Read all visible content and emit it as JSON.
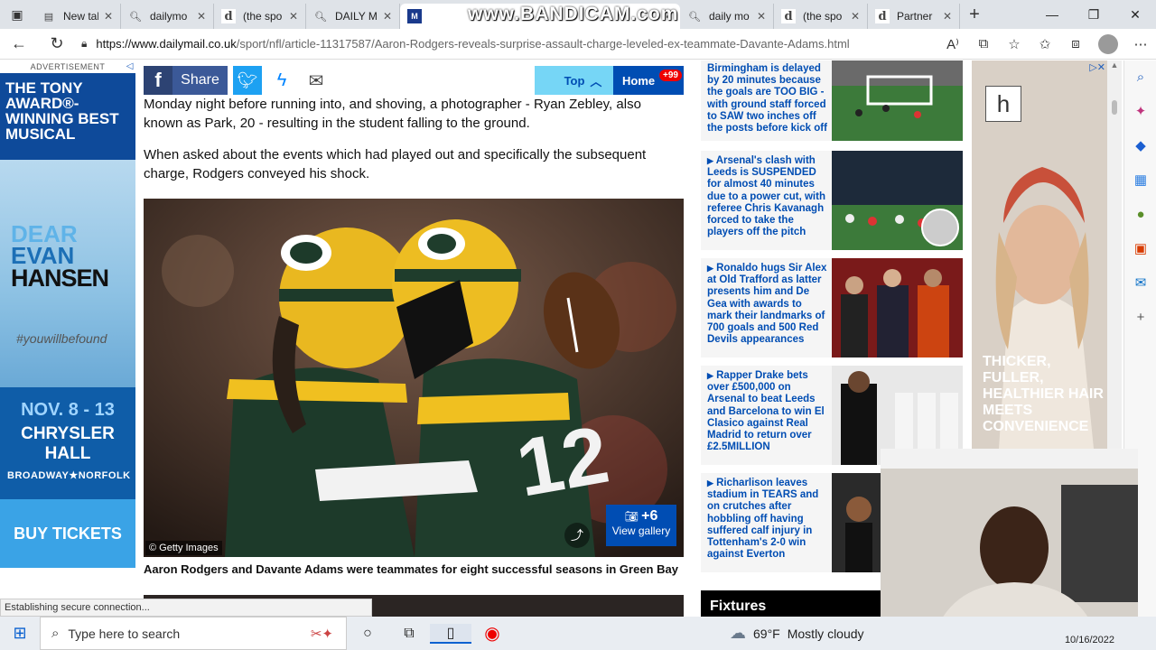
{
  "browser": {
    "tabs": [
      {
        "icon": "newtab",
        "title": "New tab"
      },
      {
        "icon": "search",
        "title": "dailymo"
      },
      {
        "icon": "doc",
        "title": "(the spo"
      },
      {
        "icon": "search",
        "title": "DAILY M"
      },
      {
        "icon": "dm",
        "title": "",
        "active": true
      },
      {
        "icon": "search",
        "title": "daily mo"
      },
      {
        "icon": "doc",
        "title": "(the spo"
      },
      {
        "icon": "doc",
        "title": "Partner"
      }
    ],
    "watermark": "www.BANDICAM.com",
    "url_host": "https://www.dailymail.co.uk",
    "url_path": "/sport/nfl/article-11317587/Aaron-Rodgers-reveals-surprise-assault-charge-leveled-ex-teammate-Davante-Adams.html",
    "status_text": "Establishing secure connection..."
  },
  "left_ad": {
    "label": "ADVERTISEMENT",
    "headline": "THE TONY AWARD®- WINNING BEST MUSICAL",
    "show_line1": "DEAR",
    "show_line2": "EVAN",
    "show_line3": "HANSEN",
    "hashtag": "#youwillbefound",
    "dates": "NOV. 8 - 13",
    "venue": "CHRYSLER HALL",
    "presenter": "BROADWAY★NORFOLK",
    "cta": "BUY TICKETS"
  },
  "article": {
    "share_label": "Share",
    "top_label": "Top",
    "home_label": "Home",
    "home_badge": "+99",
    "para1": "Monday night before running into, and shoving, a photographer - Ryan Zebley, also known as Park, 20 - resulting in the student falling to the ground.",
    "para2": "When asked about the events which had played out and specifically the subsequent charge, Rodgers conveyed his shock.",
    "photo_credit": "© Getty Images",
    "gallery_count": "+6",
    "gallery_label": "View gallery",
    "caption": "Aaron Rodgers and Davante Adams were teammates for eight successful seasons in Green Bay"
  },
  "sidebar": {
    "stories": [
      {
        "text": "Birmingham is delayed by 20 minutes because the goals are TOO BIG - with ground staff forced to SAW two inches off the posts before kick off"
      },
      {
        "text": "Arsenal's clash with Leeds is SUSPENDED for almost 40 minutes due to a power cut, with referee Chris Kavanagh forced to take the players off the pitch"
      },
      {
        "text": "Ronaldo hugs Sir Alex at Old Trafford as latter presents him and De Gea with awards to mark their landmarks of 700 goals and 500 Red Devils appearances"
      },
      {
        "text": "Rapper Drake bets over £500,000 on Arsenal to beat Leeds and Barcelona to win El Clasico against Real Madrid to return over £2.5MILLION"
      },
      {
        "text": "Richarlison leaves stadium in TEARS and on crutches after hobbling off having suffered calf injury in Tottenham's 2-0 win against Everton"
      }
    ],
    "fixtures_label": "Fixtures"
  },
  "right_ad": {
    "logo": "h",
    "copy": "THICKER, FULLER, HEALTHIER HAIR MEETS CONVENIENCE"
  },
  "taskbar": {
    "search_placeholder": "Type here to search",
    "temperature": "69°F",
    "weather": "Mostly cloudy",
    "date": "10/16/2022"
  }
}
